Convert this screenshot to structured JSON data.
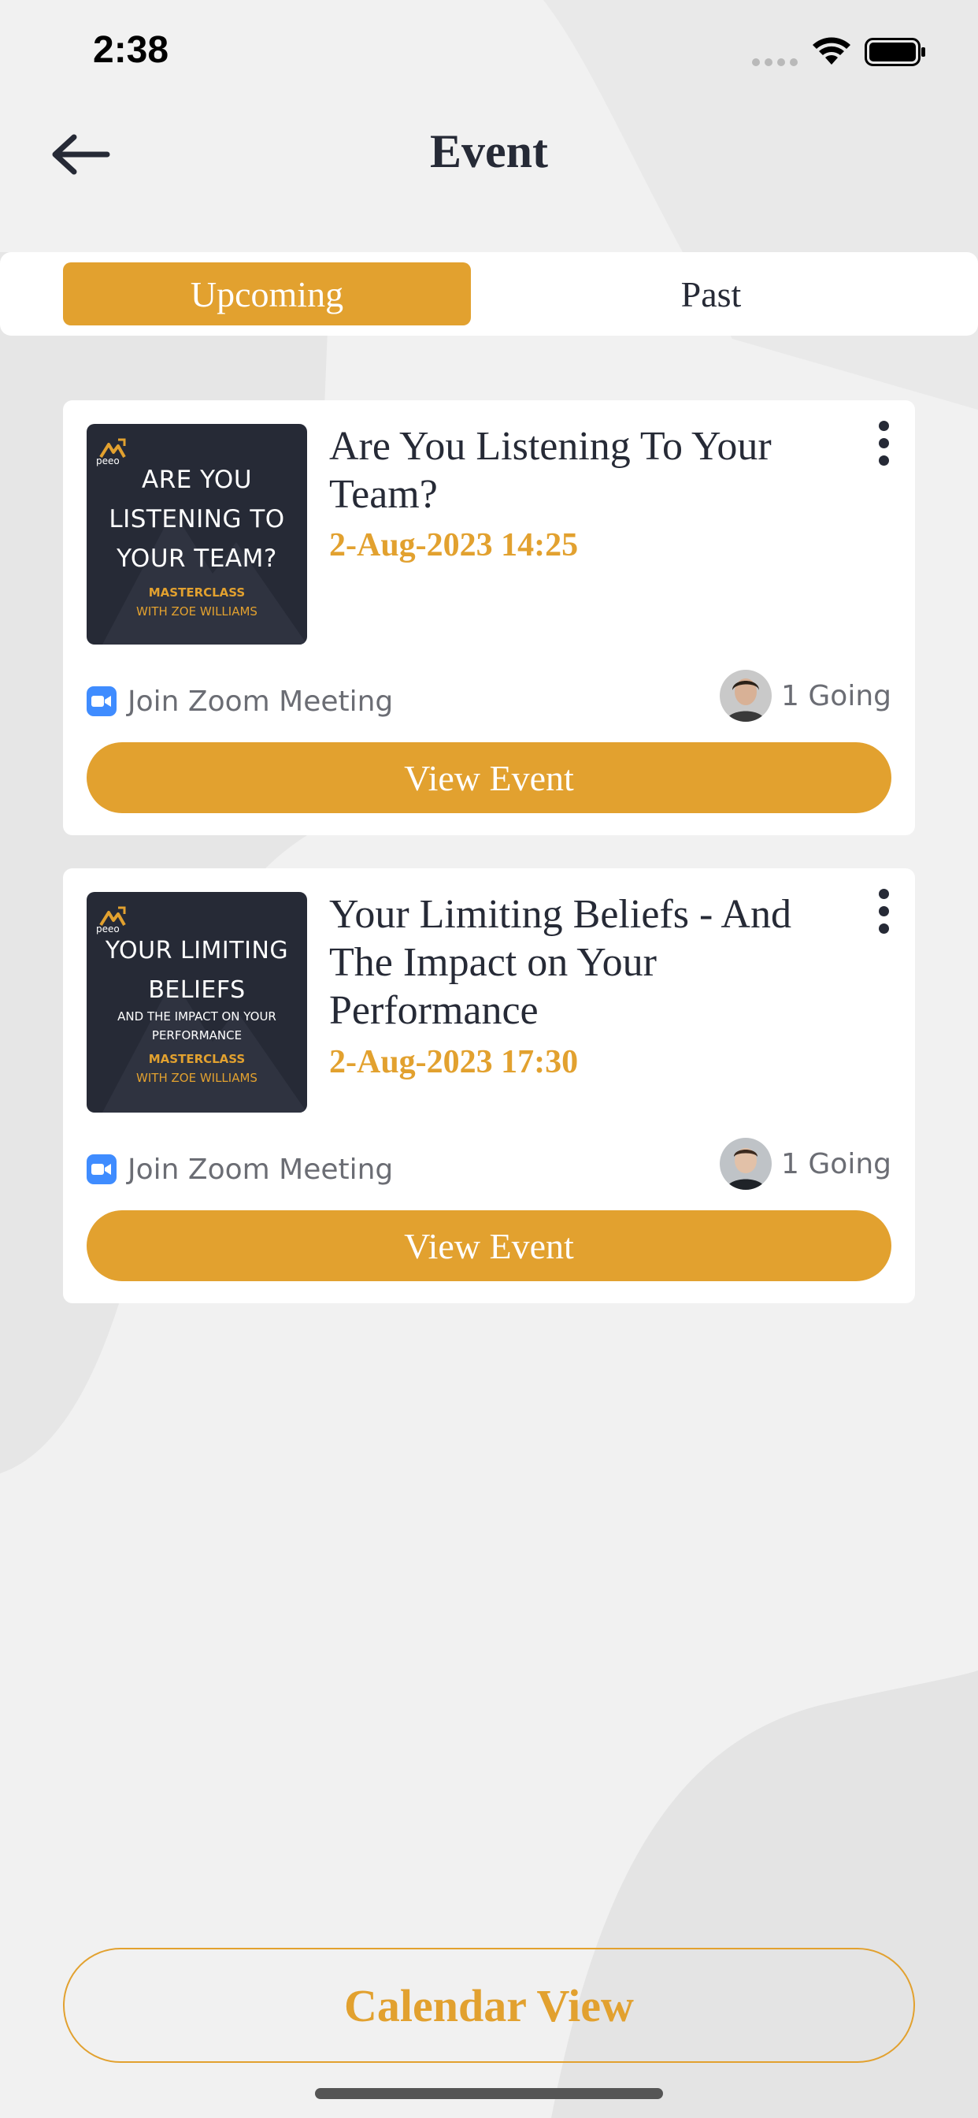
{
  "status_bar": {
    "time": "2:38"
  },
  "header": {
    "title": "Event"
  },
  "tabs": [
    {
      "label": "Upcoming",
      "active": true
    },
    {
      "label": "Past",
      "active": false
    }
  ],
  "events": [
    {
      "title": "Are You Listening To Your Team?",
      "date": "2-Aug-2023 14:25",
      "thumbnail": {
        "brand": "peeo",
        "lines": [
          "ARE YOU",
          "LISTENING TO",
          "YOUR TEAM?"
        ],
        "masterclass": [
          "MASTERCLASS",
          "WITH ZOE WILLIAMS"
        ]
      },
      "meeting_label": "Join Zoom Meeting",
      "going": "1 Going",
      "button": "View Event"
    },
    {
      "title": "Your Limiting Beliefs - And The Impact on Your Performance",
      "date": "2-Aug-2023 17:30",
      "thumbnail": {
        "brand": "peeo",
        "lines": [
          "YOUR LIMITING",
          "BELIEFS"
        ],
        "subtitle": [
          "AND THE IMPACT ON YOUR",
          "PERFORMANCE"
        ],
        "masterclass": [
          "MASTERCLASS",
          "WITH ZOE WILLIAMS"
        ]
      },
      "meeting_label": "Join Zoom Meeting",
      "going": "1 Going",
      "button": "View Event"
    }
  ],
  "calendar_button": "Calendar View",
  "colors": {
    "accent": "#e2a12f",
    "text": "#262a36",
    "background": "#f1f1f1",
    "zoom": "#3f8cff"
  }
}
